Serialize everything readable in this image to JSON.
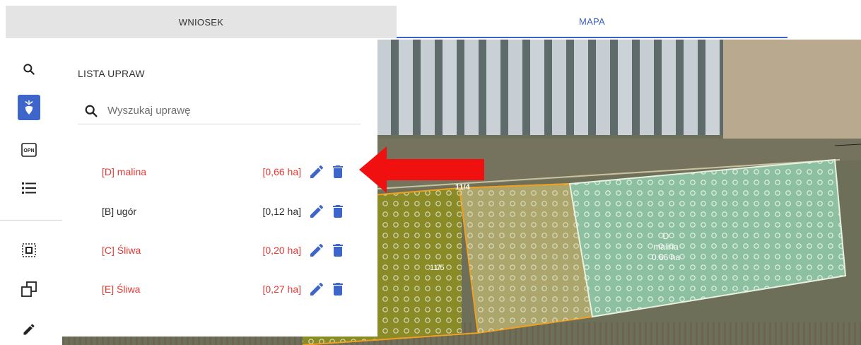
{
  "tabs": [
    {
      "label": "WNIOSEK",
      "active": false
    },
    {
      "label": "MAPA",
      "active": true
    }
  ],
  "toolbar": {
    "tools": [
      {
        "icon": "search-icon",
        "active": false
      },
      {
        "icon": "crop-plant-icon",
        "active": true
      },
      {
        "icon": "opn-icon",
        "text": "OPN",
        "active": false
      },
      {
        "icon": "list-icon",
        "active": false
      },
      {
        "icon": "select-area-icon",
        "active": false
      },
      {
        "icon": "copy-shape-icon",
        "active": false
      },
      {
        "icon": "pencil-icon",
        "active": false
      }
    ]
  },
  "panel": {
    "title": "LISTA UPRAW",
    "search_placeholder": "Wyszukaj uprawę",
    "crops": [
      {
        "name": "[D] malina",
        "area": "[0,66 ha]",
        "highlight": true
      },
      {
        "name": "[B] ugór",
        "area": "[0,12 ha]",
        "highlight": false
      },
      {
        "name": "[C] Śliwa",
        "area": "[0,20 ha]",
        "highlight": true
      },
      {
        "name": "[E] Śliwa",
        "area": "[0,27 ha]",
        "highlight": true
      }
    ]
  },
  "map": {
    "parcel_label_top": "11/4",
    "parcel_label_left": "11/5",
    "crop_label": {
      "code": "D",
      "name": "malina",
      "area": "0.66 ha"
    }
  },
  "colors": {
    "accent_blue": "#3e65c9",
    "crop_red": "#e53935",
    "arrow_red": "#f01010",
    "parcel_orange": "#f0a020"
  }
}
